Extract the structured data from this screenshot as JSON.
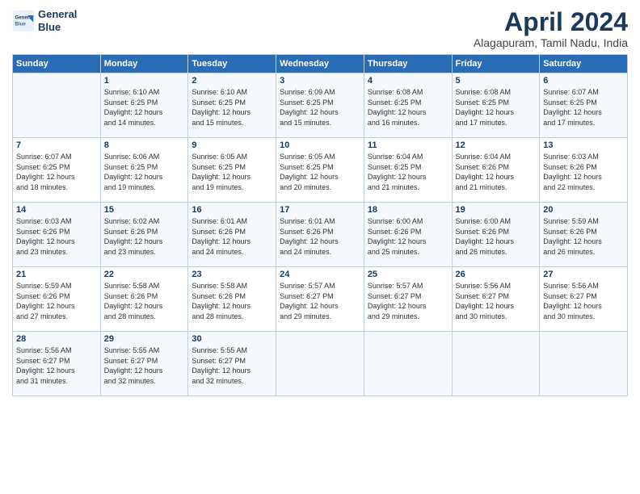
{
  "logo": {
    "line1": "General",
    "line2": "Blue"
  },
  "title": "April 2024",
  "location": "Alagapuram, Tamil Nadu, India",
  "weekdays": [
    "Sunday",
    "Monday",
    "Tuesday",
    "Wednesday",
    "Thursday",
    "Friday",
    "Saturday"
  ],
  "weeks": [
    [
      {
        "day": "",
        "info": ""
      },
      {
        "day": "1",
        "info": "Sunrise: 6:10 AM\nSunset: 6:25 PM\nDaylight: 12 hours\nand 14 minutes."
      },
      {
        "day": "2",
        "info": "Sunrise: 6:10 AM\nSunset: 6:25 PM\nDaylight: 12 hours\nand 15 minutes."
      },
      {
        "day": "3",
        "info": "Sunrise: 6:09 AM\nSunset: 6:25 PM\nDaylight: 12 hours\nand 15 minutes."
      },
      {
        "day": "4",
        "info": "Sunrise: 6:08 AM\nSunset: 6:25 PM\nDaylight: 12 hours\nand 16 minutes."
      },
      {
        "day": "5",
        "info": "Sunrise: 6:08 AM\nSunset: 6:25 PM\nDaylight: 12 hours\nand 17 minutes."
      },
      {
        "day": "6",
        "info": "Sunrise: 6:07 AM\nSunset: 6:25 PM\nDaylight: 12 hours\nand 17 minutes."
      }
    ],
    [
      {
        "day": "7",
        "info": "Sunrise: 6:07 AM\nSunset: 6:25 PM\nDaylight: 12 hours\nand 18 minutes."
      },
      {
        "day": "8",
        "info": "Sunrise: 6:06 AM\nSunset: 6:25 PM\nDaylight: 12 hours\nand 19 minutes."
      },
      {
        "day": "9",
        "info": "Sunrise: 6:05 AM\nSunset: 6:25 PM\nDaylight: 12 hours\nand 19 minutes."
      },
      {
        "day": "10",
        "info": "Sunrise: 6:05 AM\nSunset: 6:25 PM\nDaylight: 12 hours\nand 20 minutes."
      },
      {
        "day": "11",
        "info": "Sunrise: 6:04 AM\nSunset: 6:25 PM\nDaylight: 12 hours\nand 21 minutes."
      },
      {
        "day": "12",
        "info": "Sunrise: 6:04 AM\nSunset: 6:26 PM\nDaylight: 12 hours\nand 21 minutes."
      },
      {
        "day": "13",
        "info": "Sunrise: 6:03 AM\nSunset: 6:26 PM\nDaylight: 12 hours\nand 22 minutes."
      }
    ],
    [
      {
        "day": "14",
        "info": "Sunrise: 6:03 AM\nSunset: 6:26 PM\nDaylight: 12 hours\nand 23 minutes."
      },
      {
        "day": "15",
        "info": "Sunrise: 6:02 AM\nSunset: 6:26 PM\nDaylight: 12 hours\nand 23 minutes."
      },
      {
        "day": "16",
        "info": "Sunrise: 6:01 AM\nSunset: 6:26 PM\nDaylight: 12 hours\nand 24 minutes."
      },
      {
        "day": "17",
        "info": "Sunrise: 6:01 AM\nSunset: 6:26 PM\nDaylight: 12 hours\nand 24 minutes."
      },
      {
        "day": "18",
        "info": "Sunrise: 6:00 AM\nSunset: 6:26 PM\nDaylight: 12 hours\nand 25 minutes."
      },
      {
        "day": "19",
        "info": "Sunrise: 6:00 AM\nSunset: 6:26 PM\nDaylight: 12 hours\nand 26 minutes."
      },
      {
        "day": "20",
        "info": "Sunrise: 5:59 AM\nSunset: 6:26 PM\nDaylight: 12 hours\nand 26 minutes."
      }
    ],
    [
      {
        "day": "21",
        "info": "Sunrise: 5:59 AM\nSunset: 6:26 PM\nDaylight: 12 hours\nand 27 minutes."
      },
      {
        "day": "22",
        "info": "Sunrise: 5:58 AM\nSunset: 6:26 PM\nDaylight: 12 hours\nand 28 minutes."
      },
      {
        "day": "23",
        "info": "Sunrise: 5:58 AM\nSunset: 6:26 PM\nDaylight: 12 hours\nand 28 minutes."
      },
      {
        "day": "24",
        "info": "Sunrise: 5:57 AM\nSunset: 6:27 PM\nDaylight: 12 hours\nand 29 minutes."
      },
      {
        "day": "25",
        "info": "Sunrise: 5:57 AM\nSunset: 6:27 PM\nDaylight: 12 hours\nand 29 minutes."
      },
      {
        "day": "26",
        "info": "Sunrise: 5:56 AM\nSunset: 6:27 PM\nDaylight: 12 hours\nand 30 minutes."
      },
      {
        "day": "27",
        "info": "Sunrise: 5:56 AM\nSunset: 6:27 PM\nDaylight: 12 hours\nand 30 minutes."
      }
    ],
    [
      {
        "day": "28",
        "info": "Sunrise: 5:56 AM\nSunset: 6:27 PM\nDaylight: 12 hours\nand 31 minutes."
      },
      {
        "day": "29",
        "info": "Sunrise: 5:55 AM\nSunset: 6:27 PM\nDaylight: 12 hours\nand 32 minutes."
      },
      {
        "day": "30",
        "info": "Sunrise: 5:55 AM\nSunset: 6:27 PM\nDaylight: 12 hours\nand 32 minutes."
      },
      {
        "day": "",
        "info": ""
      },
      {
        "day": "",
        "info": ""
      },
      {
        "day": "",
        "info": ""
      },
      {
        "day": "",
        "info": ""
      }
    ]
  ]
}
